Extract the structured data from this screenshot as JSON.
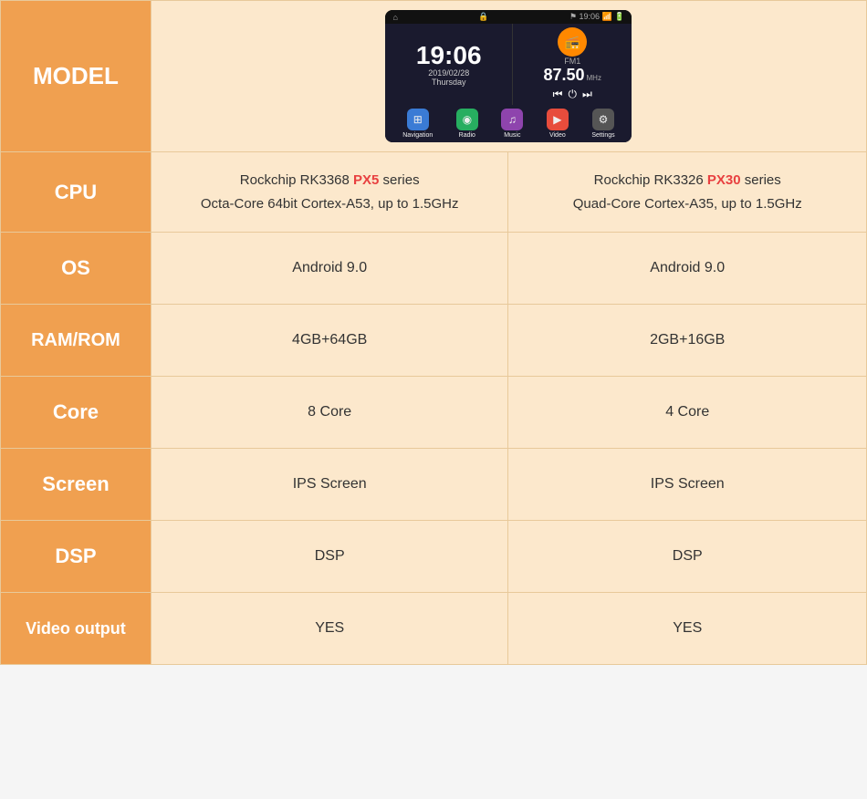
{
  "header": {
    "model_label": "MODEL"
  },
  "screen": {
    "time": "19:06",
    "date": "2019/02/28",
    "day": "Thursday",
    "fm": "FM1",
    "freq": "87.50",
    "mhz": "MHz",
    "icons": [
      {
        "label": "Navigation",
        "color": "#3a7bd5",
        "symbol": "⊞"
      },
      {
        "label": "Radio",
        "color": "#27ae60",
        "symbol": "◉"
      },
      {
        "label": "Music",
        "color": "#8e44ad",
        "symbol": "♫"
      },
      {
        "label": "Video",
        "color": "#e74c3c",
        "symbol": "▶"
      },
      {
        "label": "Settings",
        "color": "#555",
        "symbol": "⚙"
      }
    ]
  },
  "rows": [
    {
      "label": "CPU",
      "val1_line1": "Rockchip RK3368 ",
      "val1_highlight": "PX5",
      "val1_line1_suffix": " series",
      "val1_line2": "Octa-Core 64bit Cortex-A53, up to 1.5GHz",
      "val2_line1": "Rockchip RK3326 ",
      "val2_highlight": "PX30",
      "val2_line1_suffix": " series",
      "val2_line2": "Quad-Core  Cortex-A35, up to 1.5GHz"
    },
    {
      "label": "OS",
      "val1": "Android 9.0",
      "val2": "Android 9.0"
    },
    {
      "label": "RAM/ROM",
      "val1": "4GB+64GB",
      "val2": "2GB+16GB"
    },
    {
      "label": "Core",
      "val1": "8 Core",
      "val2": "4 Core"
    },
    {
      "label": "Screen",
      "val1": "IPS Screen",
      "val2": "IPS Screen"
    },
    {
      "label": "DSP",
      "val1": "DSP",
      "val2": "DSP"
    },
    {
      "label": "Video output",
      "val1": "YES",
      "val2": "YES"
    }
  ]
}
